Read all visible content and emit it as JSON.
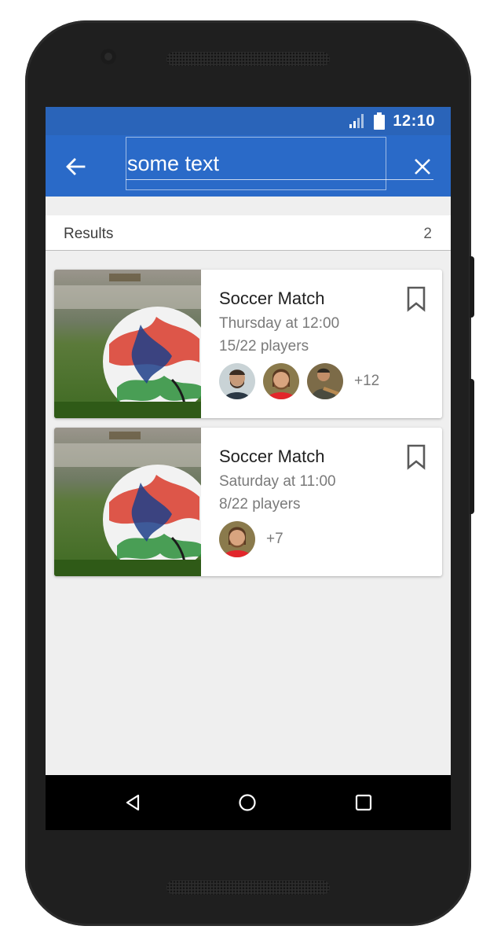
{
  "status_bar": {
    "time": "12:10",
    "signal_icon": "signal-icon",
    "battery_icon": "battery-icon"
  },
  "app_bar": {
    "back_icon": "arrow-back-icon",
    "search_value": "some text",
    "close_icon": "close-icon"
  },
  "results": {
    "label": "Results",
    "count": "2"
  },
  "cards": [
    {
      "title": "Soccer Match",
      "time": "Thursday at 12:00",
      "players": "15/22 players",
      "more": "+12",
      "bookmark_icon": "bookmark-icon"
    },
    {
      "title": "Soccer Match",
      "time": "Saturday at 11:00",
      "players": "8/22 players",
      "more": "+7",
      "bookmark_icon": "bookmark-icon"
    }
  ],
  "nav": {
    "back": "nav-back-icon",
    "home": "nav-home-icon",
    "recents": "nav-recents-icon"
  },
  "colors": {
    "status_bar": "#2a64b9",
    "app_bar": "#2a6ac8",
    "screen_bg": "#efefef"
  }
}
